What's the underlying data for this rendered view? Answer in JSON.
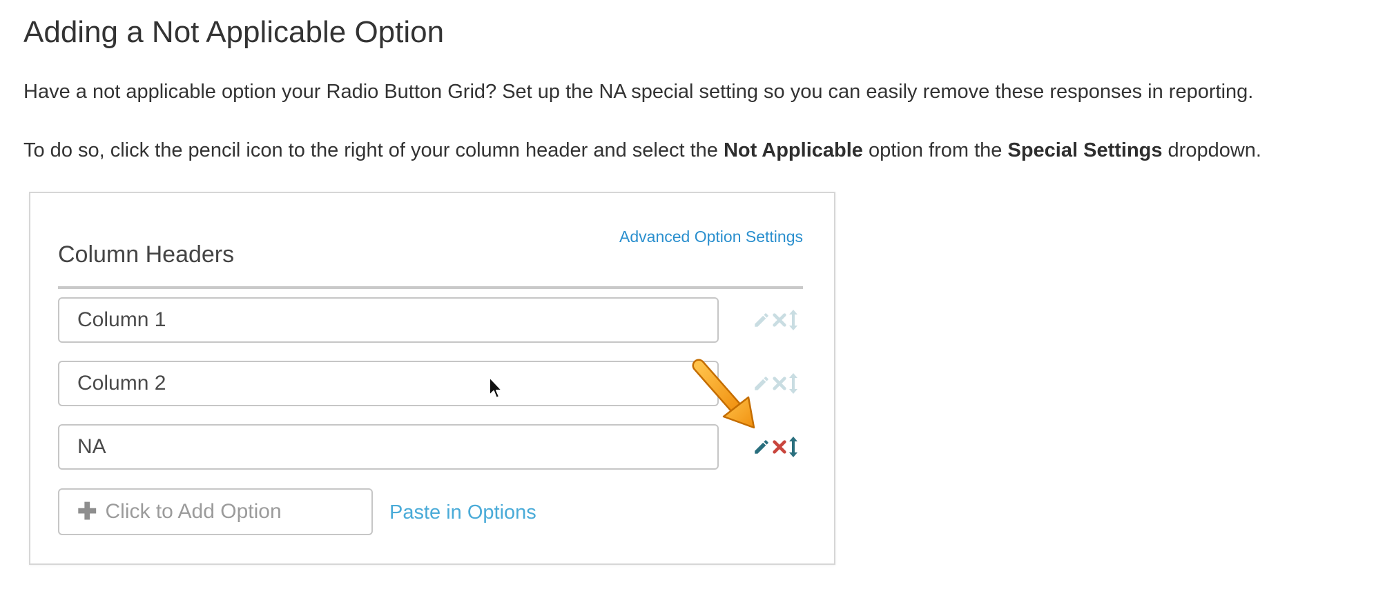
{
  "article": {
    "title": "Adding a Not Applicable Option",
    "paragraph1": "Have a not applicable option your Radio Button Grid? Set up the NA special setting so you can easily remove these responses in reporting.",
    "paragraph2": {
      "part1": "To do so, click the pencil icon to the right of your column header and select the ",
      "bold1": "Not Applicable",
      "part2": " option from the ",
      "bold2": "Special Settings",
      "part3": " dropdown."
    }
  },
  "panel": {
    "advanced_link": "Advanced Option Settings",
    "section_title": "Column Headers",
    "options": [
      {
        "value": "Column 1",
        "actions_state": "faded"
      },
      {
        "value": "Column 2",
        "actions_state": "faded"
      },
      {
        "value": "NA",
        "actions_state": "active"
      }
    ],
    "add_option_label": "Click to Add Option",
    "add_option_icon": "plus-icon",
    "paste_link": "Paste in Options"
  },
  "icons": {
    "edit": "pencil-icon",
    "delete": "close-icon",
    "reorder": "vertical-resize-icon"
  },
  "colors": {
    "link": "#2a8fce",
    "paste_link": "#4aabd8",
    "pencil_active": "#2a6f7e",
    "delete_active": "#c9453d",
    "reorder_active": "#2a6f7e",
    "faded_icon": "#c9dde2",
    "annotation_arrow": "#f5a623"
  }
}
